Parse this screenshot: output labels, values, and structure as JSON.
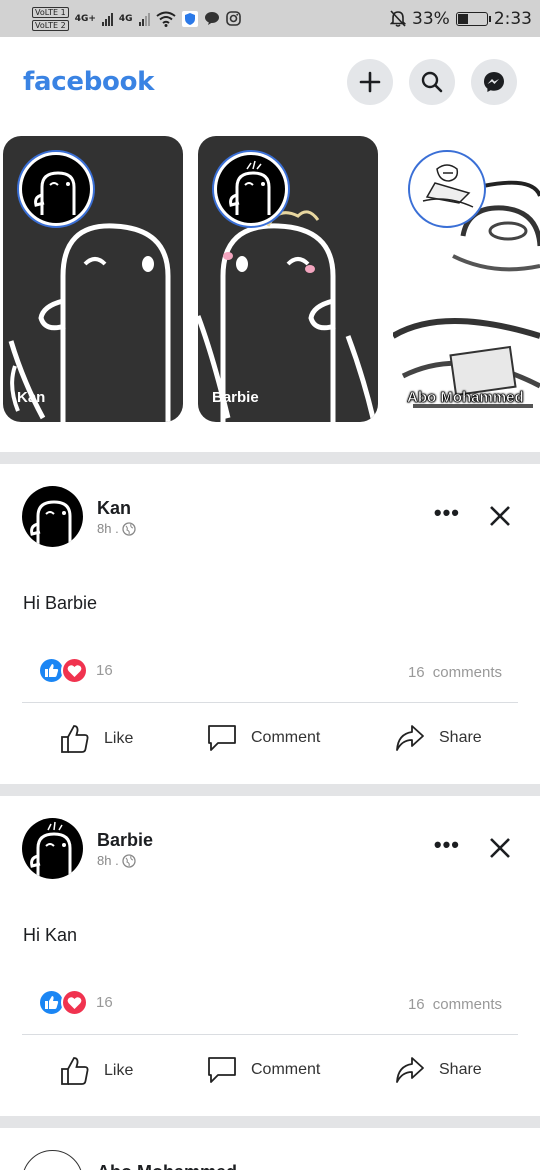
{
  "status_bar": {
    "volte1": "VoLTE 1",
    "volte2": "VoLTE 2",
    "net1": "4G+",
    "net2": "4G",
    "battery": "33%",
    "time": "2:33",
    "icons": [
      "wifi-icon",
      "shield-icon",
      "chat-bubble-icon",
      "instagram-icon",
      "mute-bell-icon"
    ]
  },
  "header": {
    "logo": "facebook",
    "icons": [
      "plus-icon",
      "search-icon",
      "messenger-icon"
    ]
  },
  "stories": [
    {
      "name": "Kan"
    },
    {
      "name": "Barbie"
    },
    {
      "name": "Abo Mohammed"
    }
  ],
  "posts": [
    {
      "author": "Kan",
      "time": "8h .",
      "text": "Hi Barbie",
      "reactions_count": "16",
      "comments": "16  comments",
      "actions": {
        "like": "Like",
        "comment": "Comment",
        "share": "Share"
      }
    },
    {
      "author": "Barbie",
      "time": "8h .",
      "text": "Hi Kan",
      "reactions_count": "16",
      "comments": "16  comments",
      "actions": {
        "like": "Like",
        "comment": "Comment",
        "share": "Share"
      }
    },
    {
      "author": "Abo Mohammed"
    }
  ],
  "colors": {
    "brand": "#3a83e3",
    "like": "#1b86f4",
    "love": "#f0334f",
    "divider": "#e3e4e6"
  }
}
